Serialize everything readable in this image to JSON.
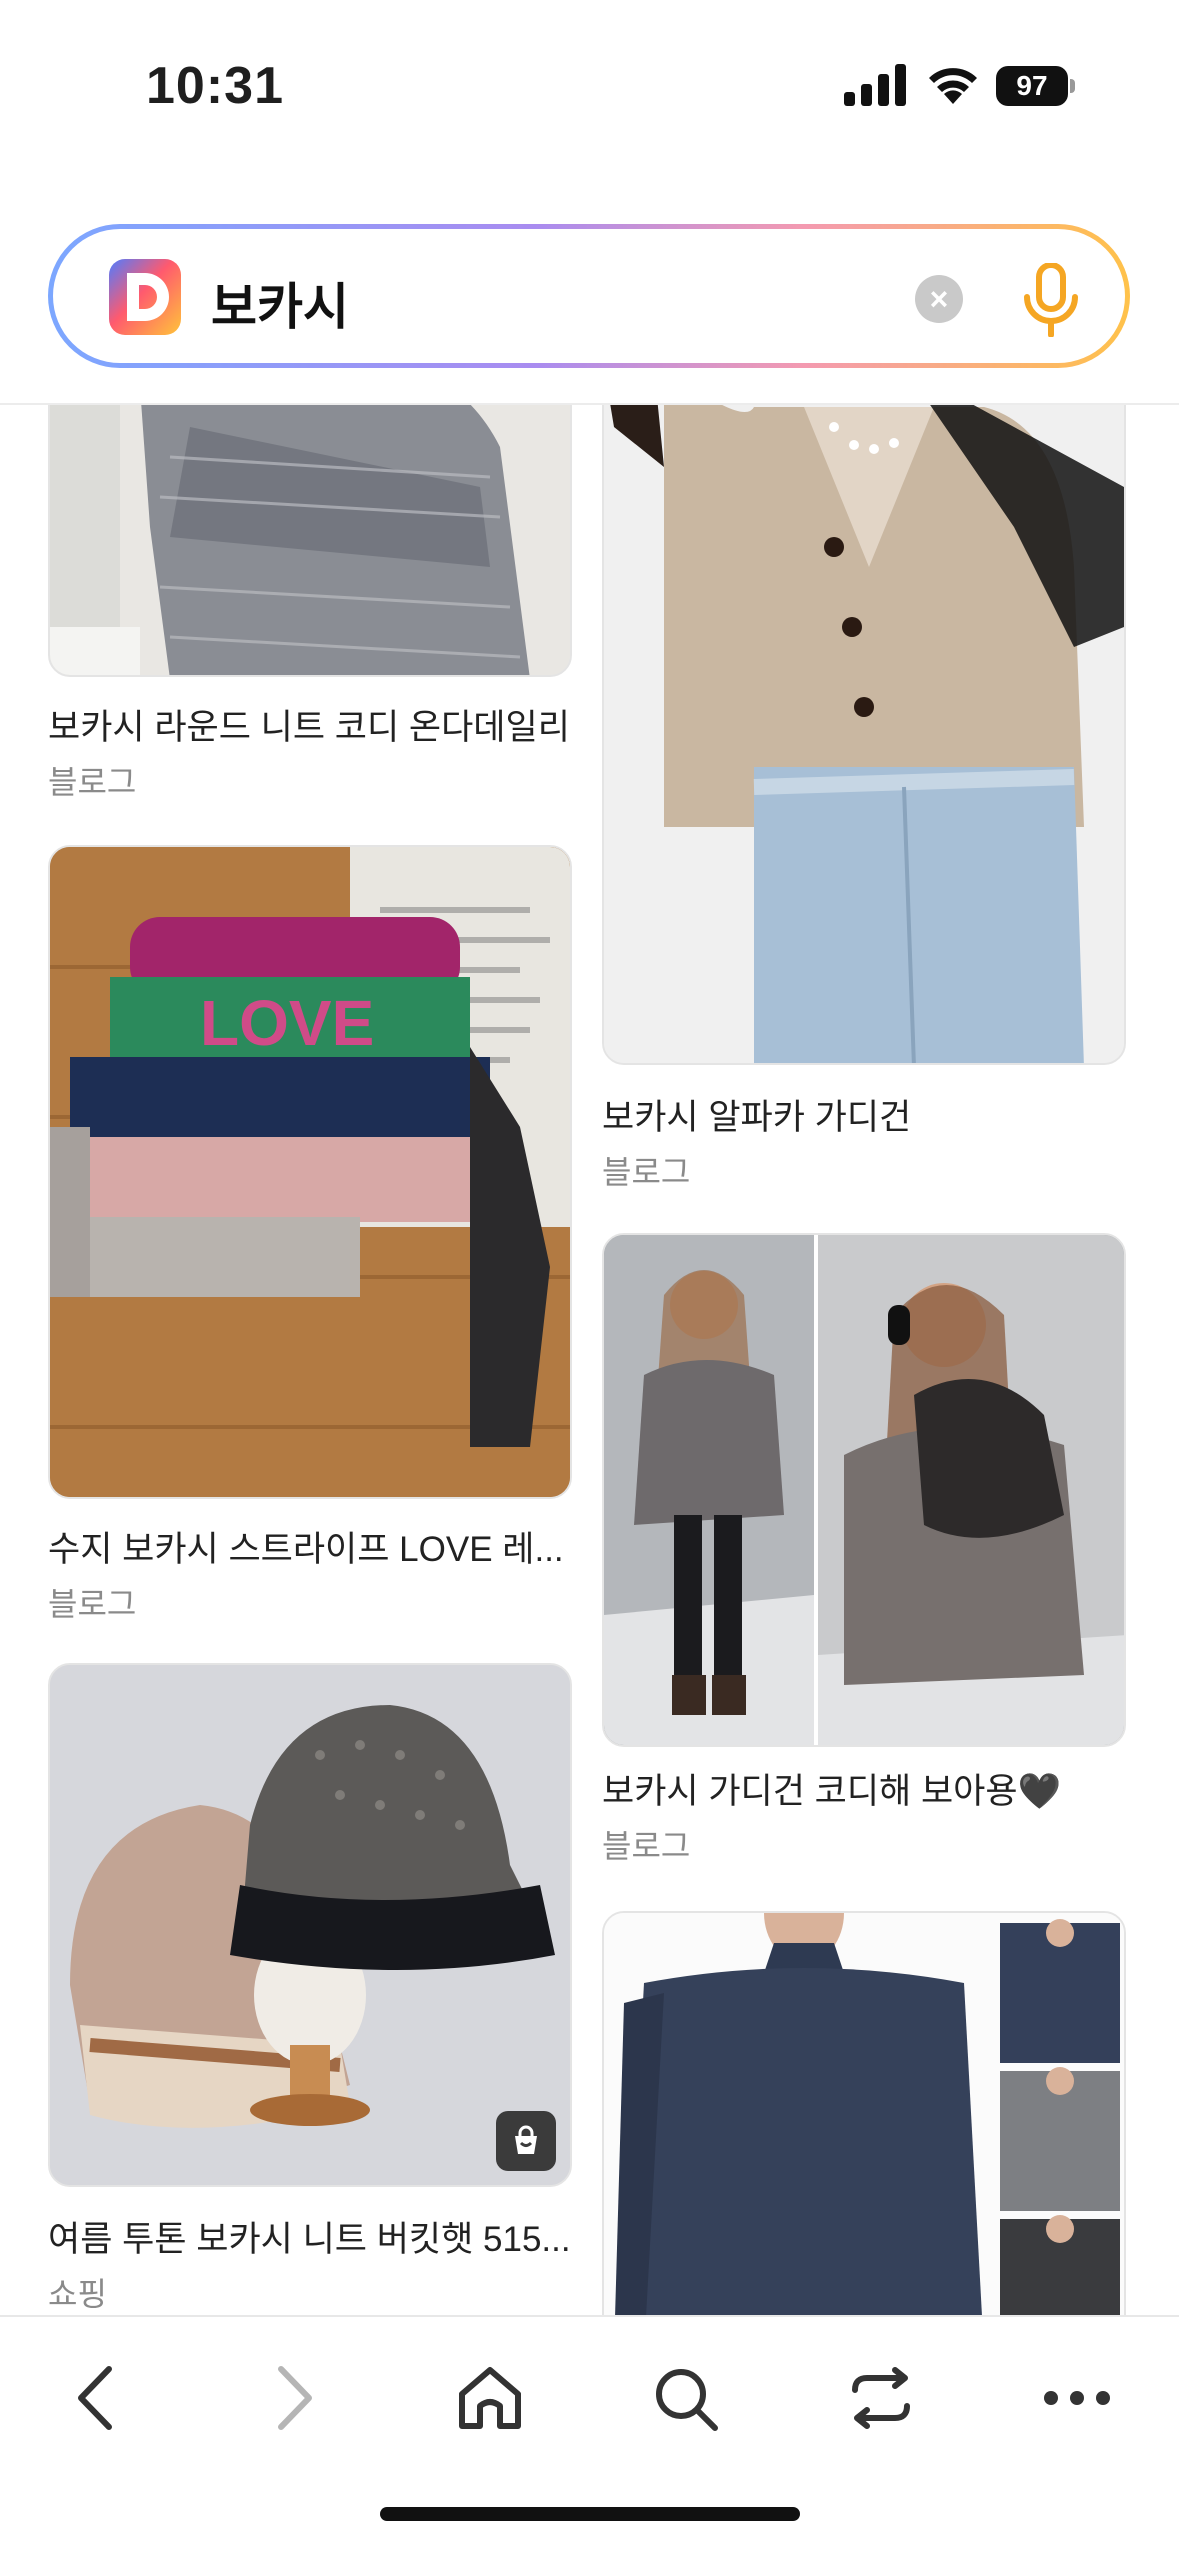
{
  "status_bar": {
    "time": "10:31",
    "battery": "97"
  },
  "search": {
    "query": "보카시"
  },
  "results": {
    "left": [
      {
        "title": "보카시 라운드 니트 코디 온다데일리",
        "source": "블로그"
      },
      {
        "title": "수지 보카시 스트라이프 LOVE 레...",
        "source": "블로그"
      },
      {
        "title": "여름 투톤 보카시 니트 버킷햇 515...",
        "source": "쇼핑"
      }
    ],
    "right": [
      {
        "title": "보카시 알파카 가디건",
        "source": "블로그"
      },
      {
        "title": "보카시 가디건 코디해 보아용🖤",
        "source": "블로그"
      }
    ]
  },
  "colors": {
    "brand_gradient_start": "#7ca7ff",
    "brand_gradient_end": "#ffc24a",
    "mic": "#f5a623"
  },
  "toolbar": {
    "icons": [
      "back-icon",
      "forward-icon",
      "home-icon",
      "search-icon",
      "tabs-icon",
      "more-icon"
    ]
  }
}
